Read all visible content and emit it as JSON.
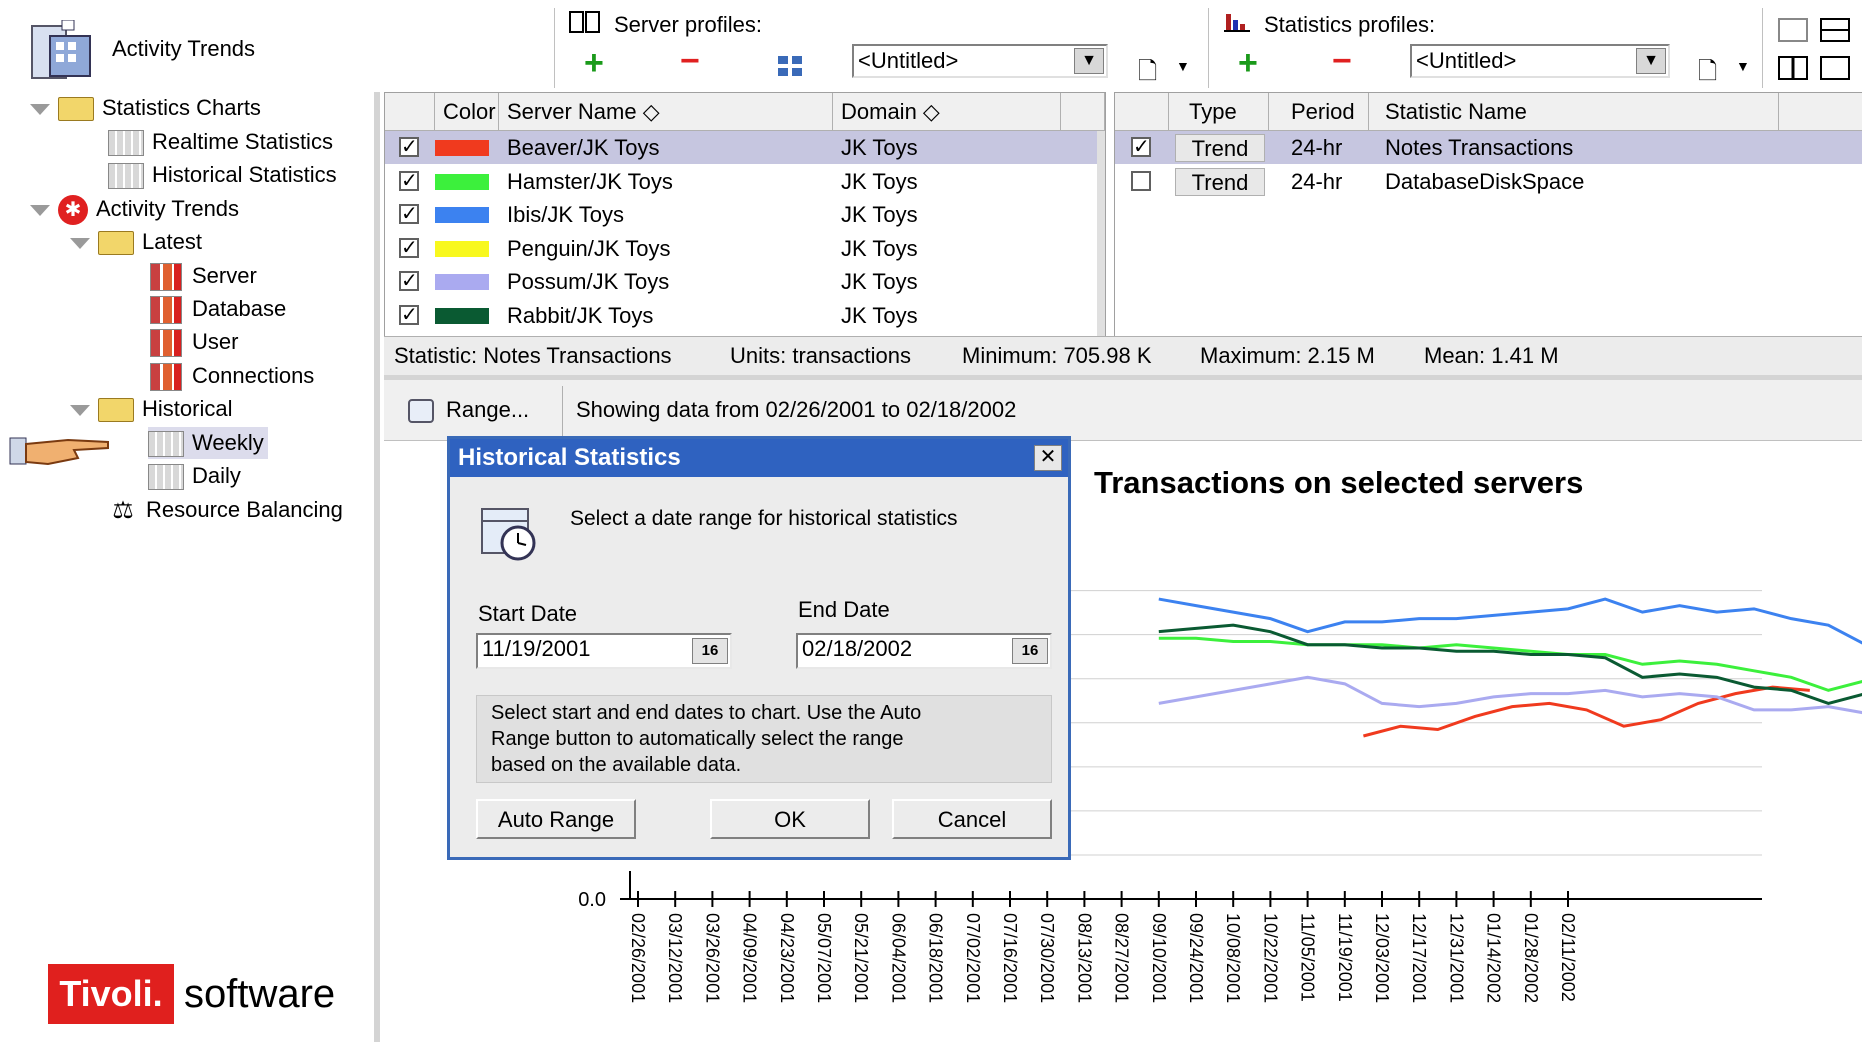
{
  "header": {
    "title": "Activity Trends",
    "server_profiles_label": "Server profiles:",
    "statistics_profiles_label": "Statistics profiles:",
    "server_profile_value": "<Untitled>",
    "stat_profile_value": "<Untitled>"
  },
  "tree": {
    "items": [
      {
        "label": "Statistics Charts"
      },
      {
        "label": "Realtime Statistics"
      },
      {
        "label": "Historical Statistics"
      },
      {
        "label": "Activity Trends"
      },
      {
        "label": "Latest"
      },
      {
        "label": "Server"
      },
      {
        "label": "Database"
      },
      {
        "label": "User"
      },
      {
        "label": "Connections"
      },
      {
        "label": "Historical"
      },
      {
        "label": "Weekly"
      },
      {
        "label": "Daily"
      },
      {
        "label": "Resource Balancing"
      }
    ]
  },
  "servers": {
    "headers": {
      "color": "Color",
      "name": "Server Name ◇",
      "domain": "Domain ◇"
    },
    "rows": [
      {
        "name": "Beaver/JK Toys",
        "domain": "JK Toys",
        "color": "#f03a1e",
        "checked": "✓"
      },
      {
        "name": "Hamster/JK Toys",
        "domain": "JK Toys",
        "color": "#3cf03c",
        "checked": "✓"
      },
      {
        "name": "Ibis/JK Toys",
        "domain": "JK Toys",
        "color": "#3c82f0",
        "checked": "✓"
      },
      {
        "name": "Penguin/JK Toys",
        "domain": "JK Toys",
        "color": "#f8f81e",
        "checked": "✓"
      },
      {
        "name": "Possum/JK Toys",
        "domain": "JK Toys",
        "color": "#aaaaf0",
        "checked": "✓"
      },
      {
        "name": "Rabbit/JK Toys",
        "domain": "JK Toys",
        "color": "#0a5a32",
        "checked": "✓"
      }
    ]
  },
  "stats": {
    "headers": {
      "type": "Type",
      "period": "Period",
      "name": "Statistic Name"
    },
    "rows": [
      {
        "type": "Trend",
        "period": "24-hr",
        "name": "Notes Transactions",
        "checked": "✓"
      },
      {
        "type": "Trend",
        "period": "24-hr",
        "name": "DatabaseDiskSpace",
        "checked": ""
      }
    ]
  },
  "statusline": {
    "statistic": "Statistic: Notes Transactions",
    "units": "Units: transactions",
    "minimum": "Minimum: 705.98 K",
    "maximum": "Maximum: 2.15 M",
    "mean": "Mean: 1.41 M"
  },
  "range": {
    "button": "Range...",
    "showing": "Showing data from 02/26/2001 to 02/18/2002"
  },
  "chart_data": {
    "type": "line",
    "title": "Transactions on selected servers",
    "y_tick_label": "0.0",
    "x": [
      "02/26/2001",
      "03/12/2001",
      "03/26/2001",
      "04/09/2001",
      "04/23/2001",
      "05/07/2001",
      "05/21/2001",
      "06/04/2001",
      "06/18/2001",
      "07/02/2001",
      "07/16/2001",
      "07/30/2001",
      "08/13/2001",
      "08/27/2001",
      "09/10/2001",
      "09/24/2001",
      "10/08/2001",
      "10/22/2001",
      "11/05/2001",
      "11/19/2001",
      "12/03/2001",
      "12/17/2001",
      "12/31/2001",
      "01/14/2002",
      "01/28/2002",
      "02/11/2002"
    ],
    "visible_x_start_index": 14,
    "series": [
      {
        "name": "Beaver/JK Toys",
        "color": "#f03a1e",
        "start_index": 19.5,
        "values": [
          0.5,
          0.53,
          0.52,
          0.56,
          0.59,
          0.6,
          0.58,
          0.53,
          0.55,
          0.6,
          0.63,
          0.65,
          0.64
        ]
      },
      {
        "name": "Hamster/JK Toys",
        "color": "#3cf03c",
        "start_index": 14,
        "values": [
          0.8,
          0.8,
          0.79,
          0.79,
          0.78,
          0.78,
          0.78,
          0.77,
          0.78,
          0.77,
          0.76,
          0.75,
          0.75,
          0.72,
          0.73,
          0.72,
          0.7,
          0.68,
          0.64,
          0.67,
          0.7,
          0.73,
          0.75,
          0.77,
          0.78
        ]
      },
      {
        "name": "Ibis/JK Toys",
        "color": "#3c82f0",
        "start_index": 14,
        "values": [
          0.92,
          0.9,
          0.88,
          0.86,
          0.82,
          0.85,
          0.85,
          0.86,
          0.86,
          0.87,
          0.88,
          0.89,
          0.92,
          0.88,
          0.9,
          0.88,
          0.89,
          0.86,
          0.84,
          0.78,
          0.83,
          0.88,
          0.87,
          0.9,
          0.93,
          0.9
        ]
      },
      {
        "name": "Possum/JK Toys",
        "color": "#aaaaf0",
        "start_index": 14,
        "values": [
          0.6,
          0.62,
          0.64,
          0.66,
          0.68,
          0.66,
          0.6,
          0.59,
          0.6,
          0.62,
          0.63,
          0.63,
          0.64,
          0.62,
          0.63,
          0.62,
          0.58,
          0.58,
          0.59,
          0.57,
          0.58,
          0.6,
          0.61,
          0.62,
          0.63,
          0.62
        ]
      },
      {
        "name": "Rabbit/JK Toys",
        "color": "#0a5a32",
        "start_index": 14,
        "values": [
          0.82,
          0.83,
          0.84,
          0.82,
          0.78,
          0.78,
          0.77,
          0.77,
          0.76,
          0.76,
          0.75,
          0.75,
          0.74,
          0.68,
          0.69,
          0.68,
          0.65,
          0.64,
          0.6,
          0.63,
          0.66,
          0.68,
          0.7,
          0.71,
          0.71
        ]
      }
    ]
  },
  "dialog": {
    "title": "Historical Statistics",
    "prompt": "Select a date range for historical statistics",
    "start_label": "Start Date",
    "end_label": "End Date",
    "start_value": "11/19/2001",
    "end_value": "02/18/2002",
    "cal_label": "16",
    "help_line1": "Select start and end dates to chart. Use the Auto",
    "help_line2": "Range button to automatically select the range",
    "help_line3": "based on the available data.",
    "auto_range": "Auto Range",
    "ok": "OK",
    "cancel": "Cancel",
    "close": "✕"
  },
  "logo": {
    "brand": "Tivoli.",
    "suffix": "software"
  }
}
